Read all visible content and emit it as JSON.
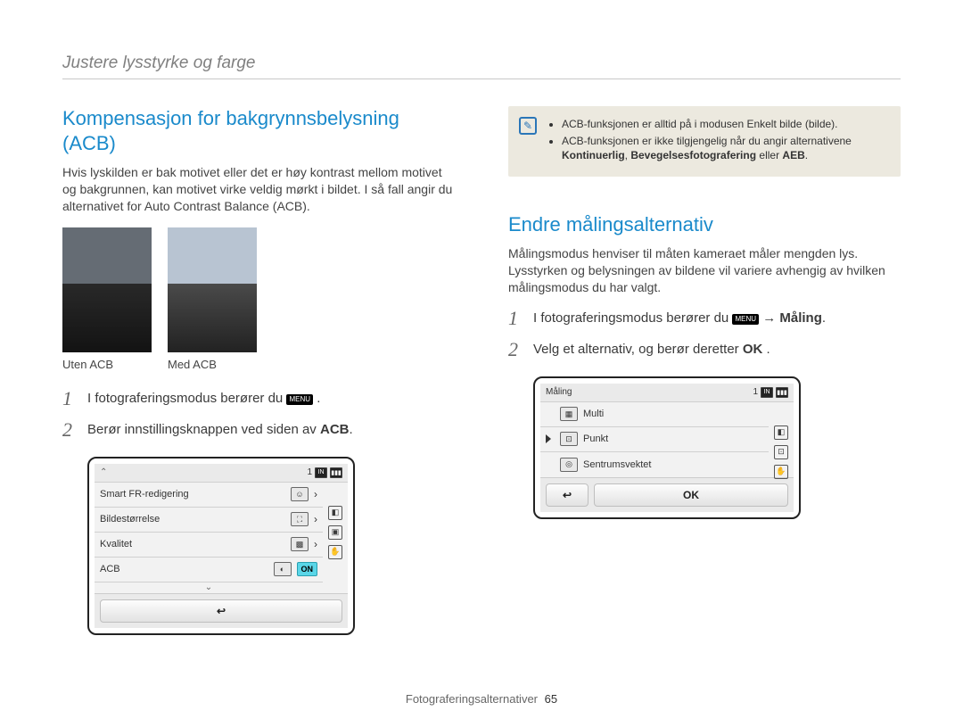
{
  "header": "Justere lysstyrke og farge",
  "left": {
    "title": "Kompensasjon for bakgrynnsbelysning (ACB)",
    "intro": "Hvis lyskilden er bak motivet eller det er høy kontrast mellom motivet og bakgrunnen, kan motivet virke veldig mørkt i bildet. I så fall angir du alternativet for Auto Contrast Balance (ACB).",
    "caption_off": "Uten ACB",
    "caption_on": "Med ACB",
    "step1_a": "I fotograferingsmodus berører du ",
    "step1_menu": "MENU",
    "step1_b": " .",
    "step2_a": "Berør innstillingsknappen ved siden av ",
    "step2_b": "ACB",
    "step2_c": ".",
    "lcd": {
      "status_num": "1",
      "status_in": "IN",
      "rows": [
        {
          "label": "Smart FR-redigering"
        },
        {
          "label": "Bildestørrelse"
        },
        {
          "label": "Kvalitet"
        },
        {
          "label": "ACB",
          "on": "ON"
        }
      ]
    }
  },
  "right": {
    "note": {
      "b1": "ACB-funksjonen er alltid på i modusen Enkelt bilde (bilde).",
      "b2_a": "ACB-funksjonen er ikke tilgjengelig når du angir alternativene ",
      "b2_b": "Kontinuerlig",
      "b2_c": ", ",
      "b2_d": "Bevegelsesfotografering",
      "b2_e": " eller ",
      "b2_f": "AEB",
      "b2_g": "."
    },
    "title": "Endre målingsalternativ",
    "intro": "Målingsmodus henviser til måten kameraet måler mengden lys. Lysstyrken og belysningen av bildene vil variere avhengig av hvilken målingsmodus du har valgt.",
    "step1_a": "I fotograferingsmodus berører du ",
    "step1_menu": "MENU",
    "step1_b": " → ",
    "step1_c": "Måling",
    "step1_d": ".",
    "step2_a": "Velg et alternativ, og berør deretter ",
    "step2_ok": "OK",
    "step2_b": " .",
    "lcd": {
      "title": "Måling",
      "status_num": "1",
      "status_in": "IN",
      "rows": [
        {
          "label": "Multi"
        },
        {
          "label": "Punkt",
          "selected": true
        },
        {
          "label": "Sentrumsvektet"
        }
      ],
      "ok": "OK"
    }
  },
  "footer": {
    "section": "Fotograferingsalternativer",
    "page": "65"
  }
}
